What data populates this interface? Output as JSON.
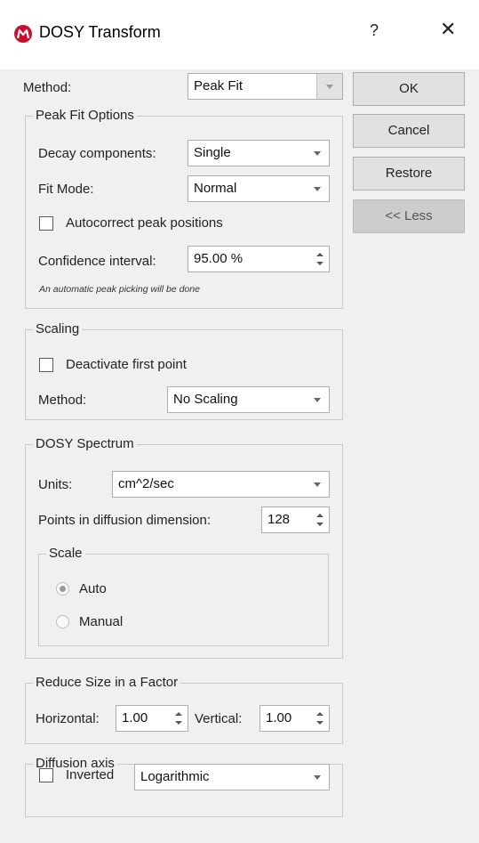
{
  "window": {
    "title": "DOSY Transform",
    "help_label": "?",
    "close_label": "✕",
    "icon": "mestrenova-logo-icon",
    "brand_color": "#c8102e"
  },
  "method": {
    "label": "Method:",
    "value": "Peak Fit"
  },
  "buttons": {
    "ok": "OK",
    "cancel": "Cancel",
    "restore": "Restore",
    "less": "<< Less"
  },
  "peak_fit": {
    "title": "Peak Fit Options",
    "decay_label": "Decay components:",
    "decay_value": "Single",
    "fit_mode_label": "Fit Mode:",
    "fit_mode_value": "Normal",
    "autocorrect_label": "Autocorrect peak positions",
    "autocorrect_checked": false,
    "confidence_label": "Confidence interval:",
    "confidence_value": "95.00 %",
    "note": "An automatic peak picking will be done"
  },
  "scaling": {
    "title": "Scaling",
    "deactivate_label": "Deactivate first point",
    "deactivate_checked": false,
    "method_label": "Method:",
    "method_value": "No Scaling"
  },
  "dosy_spectrum": {
    "title": "DOSY Spectrum",
    "units_label": "Units:",
    "units_value": "cm^2/sec",
    "points_label": "Points in diffusion dimension:",
    "points_value": "128",
    "scale": {
      "title": "Scale",
      "auto_label": "Auto",
      "manual_label": "Manual",
      "selected": "Auto"
    }
  },
  "reduce_size": {
    "title": "Reduce Size in a Factor",
    "horizontal_label": "Horizontal:",
    "horizontal_value": "1.00",
    "vertical_label": "Vertical:",
    "vertical_value": "1.00"
  },
  "diffusion_axis": {
    "title": "Diffusion axis",
    "inverted_label": "Inverted",
    "inverted_checked": false,
    "scale_value": "Logarithmic"
  }
}
